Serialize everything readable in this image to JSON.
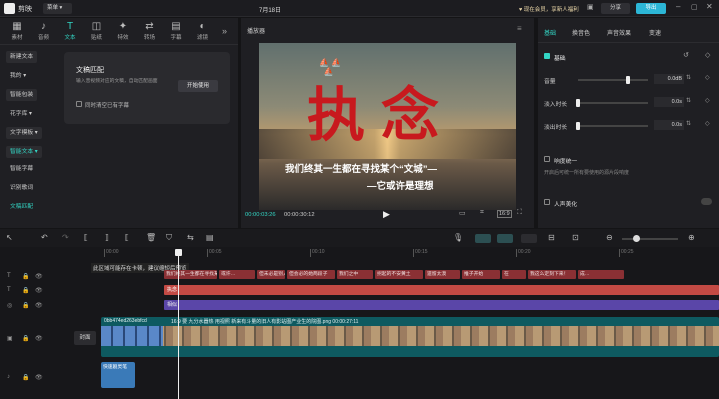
{
  "app": {
    "name": "剪映",
    "menu_label": "菜单",
    "date": "7月18日",
    "promo": "现在会员，享新人福利",
    "share": "分享",
    "export": "导出"
  },
  "colors": {
    "accent": "#33d6c5",
    "text_red": "#c8191e",
    "clip_teal": "#0e5a60",
    "sub_red": "#8a3034",
    "purple": "#5a46a8"
  },
  "toolbar": {
    "tabs": [
      "素材",
      "音频",
      "文本",
      "贴纸",
      "特效",
      "转场",
      "字幕",
      "滤镜"
    ],
    "active": 2
  },
  "sidebar": {
    "items": [
      "新建文本",
      "我的",
      "智能包装",
      "花字库",
      "文字模板",
      "智能文本",
      "智能字幕",
      "识别歌词",
      "文稿匹配"
    ]
  },
  "text_panel": {
    "title": "文稿匹配",
    "desc": "输入音视频对应的文稿，自动匹配画面",
    "start": "开始使用",
    "checkbox": "同时清空已有字幕"
  },
  "player": {
    "label": "播放器",
    "time_current": "00:00:03:26",
    "time_total": "00:00:30:12",
    "ratio": "16:9",
    "big_text": "执念",
    "sub_line1": "我们终其一生都在寻找某个“文城”—",
    "sub_line2": "—它或许是理想"
  },
  "inspector": {
    "tabs": [
      "基础",
      "换音色",
      "声音效果",
      "变速"
    ],
    "basic": "基础",
    "rows": [
      {
        "label": "音量",
        "value": "0.0dB",
        "pct": 0.72
      },
      {
        "label": "淡入时长",
        "value": "0.0s",
        "pct": 0.0
      },
      {
        "label": "淡出时长",
        "value": "0.0s",
        "pct": 0.0
      }
    ],
    "loudness": "响度统一",
    "loudness_desc": "开启后可统一所有要使用的源片段响度",
    "enhance": "人声美化"
  },
  "timeline": {
    "ticks": [
      "00:00",
      "00:05",
      "00:10",
      "00:15",
      "00:20",
      "00:25"
    ],
    "hint": "此区域可能存在卡顿，建议缩短后预览",
    "subtitles": [
      "我们终其一生都在寻找某",
      "或许…",
      "但未必是别人",
      "但会必的她两段子",
      "我们之中",
      "拐起的不安黄土",
      "遗留太漠",
      "推子开始",
      "在",
      "我这么定刻下来！",
      "成…"
    ],
    "text_clip": "执念",
    "sticker_clip": "相似",
    "video_label": "0bb474ed263ebfcd",
    "video_desc": "16:9  要 九分水器热 用视照 新来有斗量的旧人有影站图产业生的院图.png  00:00:27:11",
    "cover": "封面",
    "audio_label": "快速剧灵笔"
  }
}
